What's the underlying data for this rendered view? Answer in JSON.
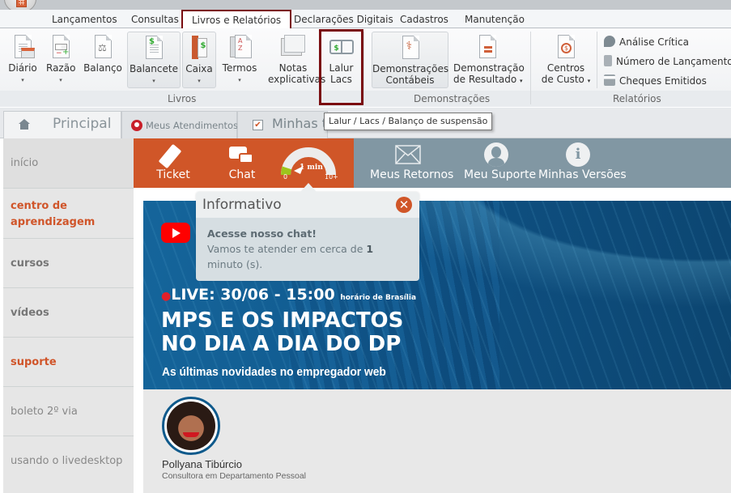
{
  "menu": {
    "tabs": [
      {
        "label": "Lançamentos"
      },
      {
        "label": "Consultas"
      },
      {
        "label": "Livros e Relatórios",
        "active": true
      },
      {
        "label": "Declarações Digitais"
      },
      {
        "label": "Cadastros"
      },
      {
        "label": "Manutenção"
      }
    ]
  },
  "ribbon": {
    "groups": {
      "livros": "Livros",
      "demonstracoes": "Demonstrações",
      "relatorios": "Relatórios"
    },
    "buttons": {
      "diario": "Diário",
      "razao": "Razão",
      "balanco": "Balanço",
      "balancete": "Balancete",
      "caixa": "Caixa",
      "termos": "Termos",
      "notas_l1": "Notas",
      "notas_l2": "explicativas",
      "lalur_l1": "Lalur",
      "lalur_l2": "Lacs",
      "dem_cont_l1": "Demonstrações",
      "dem_cont_l2": "Contábeis",
      "dem_res_l1": "Demonstração",
      "dem_res_l2": "de Resultado",
      "centros_l1": "Centros",
      "centros_l2": "de Custo"
    },
    "small_items": [
      {
        "label": "Análise Crítica",
        "icon": "magnifier-warning-icon"
      },
      {
        "label": "Número de Lançamentos",
        "icon": "numbered-doc-icon"
      },
      {
        "label": "Cheques Emitidos",
        "icon": "cheque-icon"
      }
    ],
    "dropdown_arrow": "▾"
  },
  "tooltip": "Lalur / Lacs / Balanço de suspensão",
  "tabs": {
    "principal": "Principal",
    "atendimentos": "Meus Atendimentos",
    "tarefas": "Minhas tare"
  },
  "leftnav": [
    {
      "label": "início"
    },
    {
      "label": "centro de",
      "label2": "aprendizagem"
    },
    {
      "label": "cursos"
    },
    {
      "label": "vídeos"
    },
    {
      "label": "suporte"
    },
    {
      "label": "boleto 2º via"
    },
    {
      "label": "usando o livedesktop"
    }
  ],
  "actions": {
    "ticket": "Ticket",
    "chat": "Chat",
    "gauge": {
      "label": "1 min",
      "min": "0",
      "max": "10+",
      "value_fraction": 0.1
    },
    "retornos": "Meus Retornos",
    "suporte": "Meu Suporte",
    "versoes": "Minhas Versões"
  },
  "popup": {
    "title": "Informativo",
    "heading": "Acesse nosso chat!",
    "text_before": "Vamos te atender em cerca de ",
    "text_bold": "1",
    "text_after": " minuto (s).",
    "close": "✕"
  },
  "banner": {
    "live_label": "LIVE: 30/06 - 15:00",
    "live_suffix": "horário de Brasília",
    "title_l1": "MPS E OS IMPACTOS",
    "title_l2": "NO DIA A DIA DO DP",
    "subtitle": "As últimas novidades no empregador web",
    "presenter_name": "Pollyana Tibúrcio",
    "presenter_role": "Consultora em Departamento Pessoal"
  },
  "colors": {
    "accent_orange": "#d05628",
    "slate": "#8197a3",
    "highlight_border": "#7a0c10",
    "banner_blue": "#0e4f80"
  }
}
